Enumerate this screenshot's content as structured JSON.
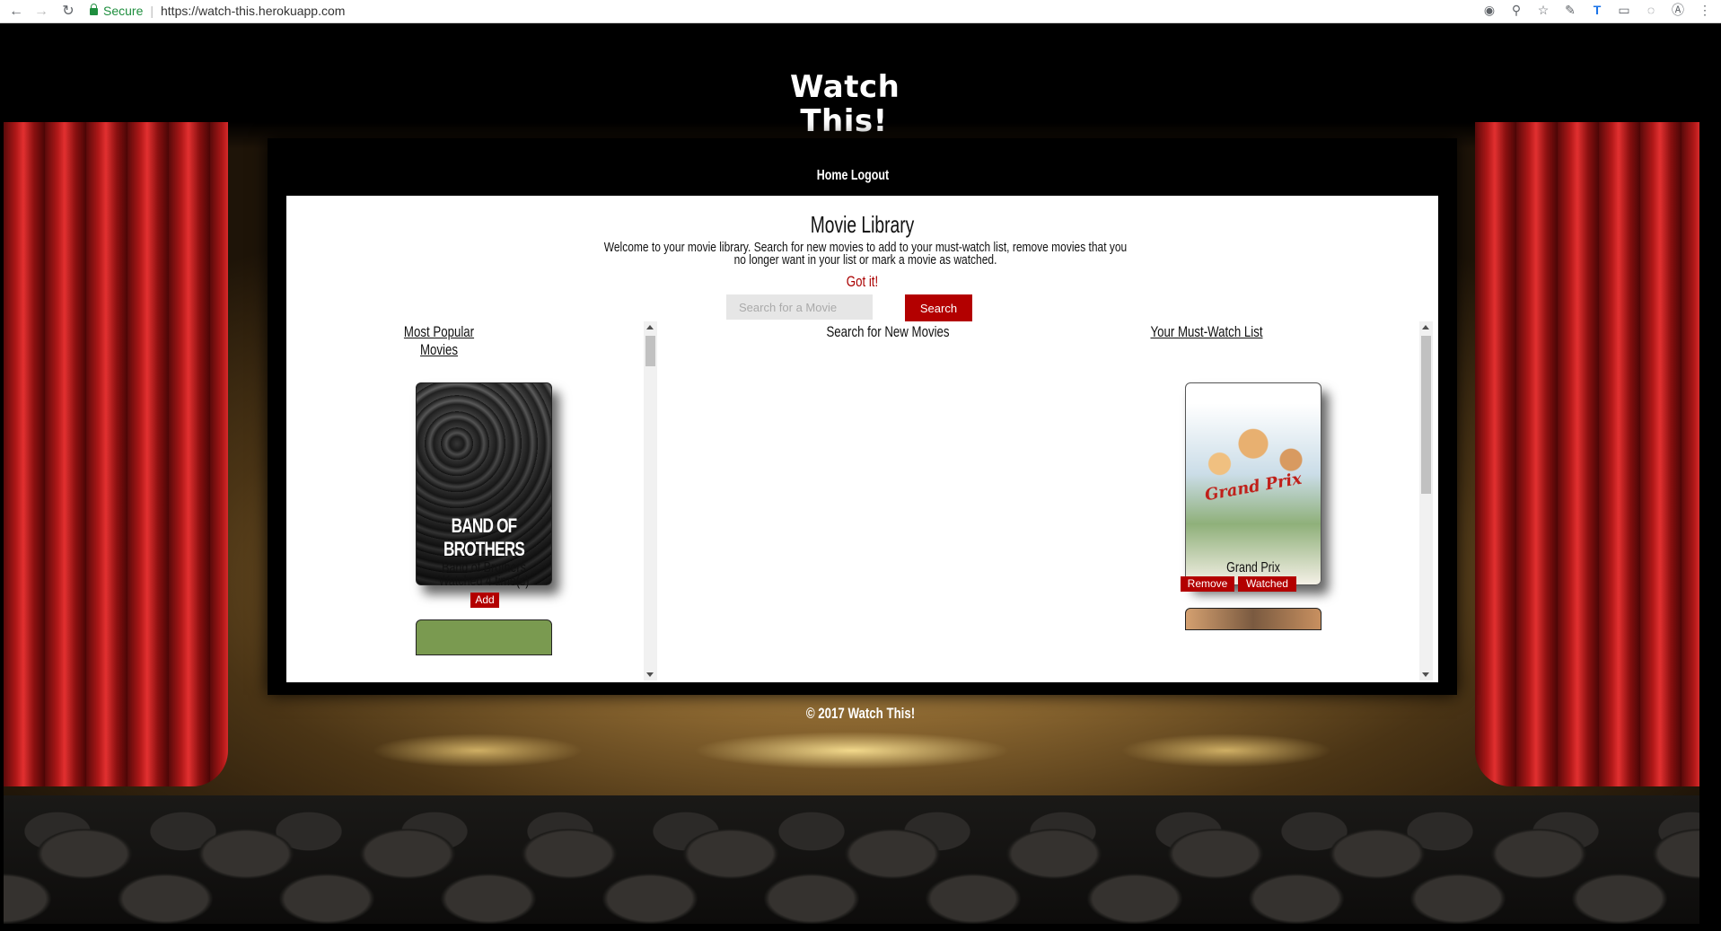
{
  "browser": {
    "secure_label": "Secure",
    "url": "https://watch-this.herokuapp.com"
  },
  "site": {
    "title_line1": "Watch",
    "title_line2": "This!",
    "nav_home": "Home",
    "nav_logout": "Logout",
    "footer": "© 2017 Watch This!"
  },
  "library": {
    "title": "Movie Library",
    "welcome": "Welcome to your movie library. Search for new movies to add to your must-watch list, remove movies that you no longer want in your list or mark a movie as watched.",
    "got_it": "Got it!",
    "search_placeholder": "Search for a Movie",
    "search_button": "Search"
  },
  "columns": {
    "popular": {
      "heading": "Most Popular Movies",
      "movies": [
        {
          "title": "Band of Brothers",
          "watched": "Watched 4 time(s)",
          "poster_text": "BAND OF BROTHERS",
          "add_label": "Add"
        }
      ]
    },
    "search": {
      "heading": "Search for New Movies"
    },
    "mustwatch": {
      "heading": "Your Must-Watch List",
      "movies": [
        {
          "title": "Grand Prix",
          "poster_text": "Grand Prix",
          "remove_label": "Remove",
          "watched_label": "Watched"
        }
      ]
    }
  },
  "colors": {
    "accent_red": "#b30000",
    "got_it_red": "#aa0000"
  }
}
